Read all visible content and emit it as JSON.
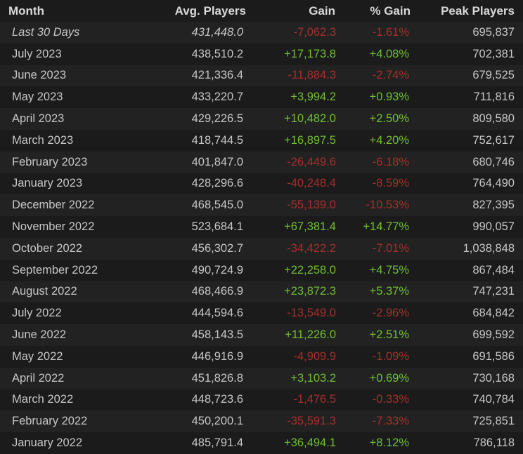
{
  "headers": {
    "month": "Month",
    "avg": "Avg. Players",
    "gain": "Gain",
    "pct": "% Gain",
    "peak": "Peak Players"
  },
  "colors": {
    "background": "#1b1b1b",
    "row_alt": "#222222",
    "text": "#c6c6c6",
    "positive": "#6fbf34",
    "negative": "#a4302a"
  },
  "rows": [
    {
      "month": "Last 30 Days",
      "avg": "431,448.0",
      "gain": "-7,062.3",
      "pct": "-1.61%",
      "peak": "695,837",
      "trend": "neg",
      "summary": true
    },
    {
      "month": "July 2023",
      "avg": "438,510.2",
      "gain": "+17,173.8",
      "pct": "+4.08%",
      "peak": "702,381",
      "trend": "pos"
    },
    {
      "month": "June 2023",
      "avg": "421,336.4",
      "gain": "-11,884.3",
      "pct": "-2.74%",
      "peak": "679,525",
      "trend": "neg"
    },
    {
      "month": "May 2023",
      "avg": "433,220.7",
      "gain": "+3,994.2",
      "pct": "+0.93%",
      "peak": "711,816",
      "trend": "pos"
    },
    {
      "month": "April 2023",
      "avg": "429,226.5",
      "gain": "+10,482.0",
      "pct": "+2.50%",
      "peak": "809,580",
      "trend": "pos"
    },
    {
      "month": "March 2023",
      "avg": "418,744.5",
      "gain": "+16,897.5",
      "pct": "+4.20%",
      "peak": "752,617",
      "trend": "pos"
    },
    {
      "month": "February 2023",
      "avg": "401,847.0",
      "gain": "-26,449.6",
      "pct": "-6.18%",
      "peak": "680,746",
      "trend": "neg"
    },
    {
      "month": "January 2023",
      "avg": "428,296.6",
      "gain": "-40,248.4",
      "pct": "-8.59%",
      "peak": "764,490",
      "trend": "neg"
    },
    {
      "month": "December 2022",
      "avg": "468,545.0",
      "gain": "-55,139.0",
      "pct": "-10.53%",
      "peak": "827,395",
      "trend": "neg"
    },
    {
      "month": "November 2022",
      "avg": "523,684.1",
      "gain": "+67,381.4",
      "pct": "+14.77%",
      "peak": "990,057",
      "trend": "pos"
    },
    {
      "month": "October 2022",
      "avg": "456,302.7",
      "gain": "-34,422.2",
      "pct": "-7.01%",
      "peak": "1,038,848",
      "trend": "neg"
    },
    {
      "month": "September 2022",
      "avg": "490,724.9",
      "gain": "+22,258.0",
      "pct": "+4.75%",
      "peak": "867,484",
      "trend": "pos"
    },
    {
      "month": "August 2022",
      "avg": "468,466.9",
      "gain": "+23,872.3",
      "pct": "+5.37%",
      "peak": "747,231",
      "trend": "pos"
    },
    {
      "month": "July 2022",
      "avg": "444,594.6",
      "gain": "-13,549.0",
      "pct": "-2.96%",
      "peak": "684,842",
      "trend": "neg"
    },
    {
      "month": "June 2022",
      "avg": "458,143.5",
      "gain": "+11,226.0",
      "pct": "+2.51%",
      "peak": "699,592",
      "trend": "pos"
    },
    {
      "month": "May 2022",
      "avg": "446,916.9",
      "gain": "-4,909.9",
      "pct": "-1.09%",
      "peak": "691,586",
      "trend": "neg"
    },
    {
      "month": "April 2022",
      "avg": "451,826.8",
      "gain": "+3,103.2",
      "pct": "+0.69%",
      "peak": "730,168",
      "trend": "pos"
    },
    {
      "month": "March 2022",
      "avg": "448,723.6",
      "gain": "-1,476.5",
      "pct": "-0.33%",
      "peak": "740,784",
      "trend": "neg"
    },
    {
      "month": "February 2022",
      "avg": "450,200.1",
      "gain": "-35,591.3",
      "pct": "-7.33%",
      "peak": "725,851",
      "trend": "neg"
    },
    {
      "month": "January 2022",
      "avg": "485,791.4",
      "gain": "+36,494.1",
      "pct": "+8.12%",
      "peak": "786,118",
      "trend": "pos"
    }
  ]
}
